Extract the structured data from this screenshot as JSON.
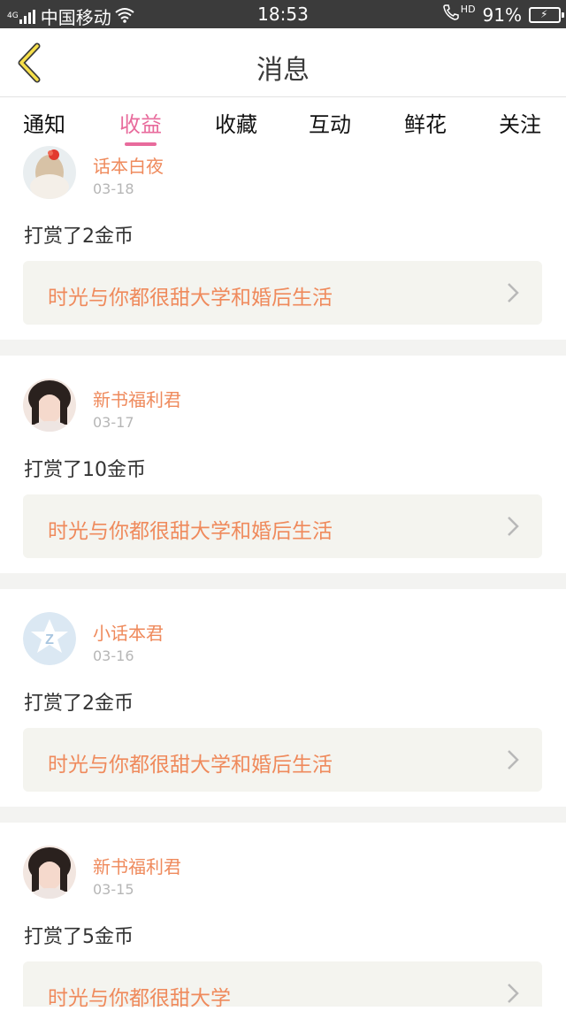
{
  "status_bar": {
    "network_small": "4G",
    "carrier": "中国移动",
    "time": "18:53",
    "hd": "HD",
    "battery": "91%",
    "battery_color": "#38d248"
  },
  "nav": {
    "back_icon": "chevron-left-icon",
    "title": "消息"
  },
  "tabs": [
    {
      "label": "通知",
      "active": false
    },
    {
      "label": "收益",
      "active": true
    },
    {
      "label": "收藏",
      "active": false
    },
    {
      "label": "互动",
      "active": false
    },
    {
      "label": "鲜花",
      "active": false
    },
    {
      "label": "关注",
      "active": false
    }
  ],
  "accent_color": "#e86b9c",
  "name_color": "#ef8a5c",
  "messages": [
    {
      "user": "话本白夜",
      "date": "03-18",
      "action": "打赏了2金币",
      "book": "时光与你都很甜大学和婚后生活",
      "avatar": "girl-flower-avatar"
    },
    {
      "user": "新书福利君",
      "date": "03-17",
      "action": "打赏了10金币",
      "book": "时光与你都很甜大学和婚后生活",
      "avatar": "girl-portrait-avatar"
    },
    {
      "user": "小话本君",
      "date": "03-16",
      "action": "打赏了2金币",
      "book": "时光与你都很甜大学和婚后生活",
      "avatar": "z-logo-avatar"
    },
    {
      "user": "新书福利君",
      "date": "03-15",
      "action": "打赏了5金币",
      "book": "时光与你都很甜大学",
      "avatar": "girl-portrait-avatar"
    }
  ]
}
